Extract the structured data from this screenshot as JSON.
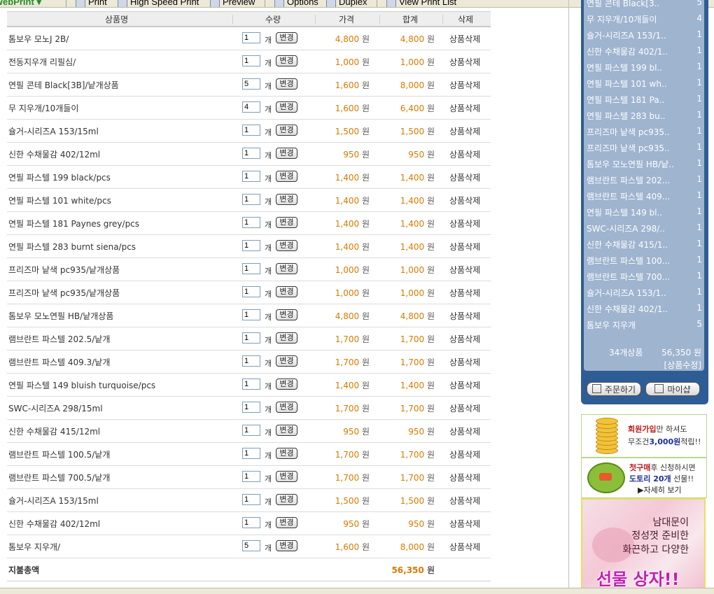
{
  "toolbar": {
    "brand": "WebPrint",
    "print": "Print",
    "high_speed_print": "High Speed Print",
    "preview": "Preview",
    "options": "Options",
    "duplex": "Duplex",
    "view_print_list": "View Print List"
  },
  "cart": {
    "headers": {
      "name": "상품명",
      "qty": "수량",
      "price": "가격",
      "total": "합계",
      "delete": "삭제"
    },
    "unit_label": "개",
    "change_label": "변경",
    "won": "원",
    "delete_label": "상품삭제",
    "items": [
      {
        "name": "톰보우 모노J 2B/",
        "qty": "1",
        "price": "4,800",
        "total": "4,800"
      },
      {
        "name": "전동지우개 리필심/",
        "qty": "1",
        "price": "1,000",
        "total": "1,000"
      },
      {
        "name": "연필 콘테 Black[3B]/낱개상품",
        "qty": "5",
        "price": "1,600",
        "total": "8,000"
      },
      {
        "name": "무 지우개/10개들이",
        "qty": "4",
        "price": "1,600",
        "total": "6,400"
      },
      {
        "name": "슐거-시리즈A 153/15ml",
        "qty": "1",
        "price": "1,500",
        "total": "1,500"
      },
      {
        "name": "신한 수채물감 402/12ml",
        "qty": "1",
        "price": "950",
        "total": "950"
      },
      {
        "name": "연필 파스텔 199 black/pcs",
        "qty": "1",
        "price": "1,400",
        "total": "1,400"
      },
      {
        "name": "연필 파스텔 101 white/pcs",
        "qty": "1",
        "price": "1,400",
        "total": "1,400"
      },
      {
        "name": "연필 파스텔 181 Paynes grey/pcs",
        "qty": "1",
        "price": "1,400",
        "total": "1,400"
      },
      {
        "name": "연필 파스텔 283 burnt siena/pcs",
        "qty": "1",
        "price": "1,400",
        "total": "1,400"
      },
      {
        "name": "프리즈마 낱색 pc935/낱개상품",
        "qty": "1",
        "price": "1,000",
        "total": "1,000"
      },
      {
        "name": "프리즈마 낱색 pc935/낱개상품",
        "qty": "1",
        "price": "1,000",
        "total": "1,000"
      },
      {
        "name": "톰보우 모노연필 HB/낱개상품",
        "qty": "1",
        "price": "4,800",
        "total": "4,800"
      },
      {
        "name": "램브란트 파스텔 202.5/낱개",
        "qty": "1",
        "price": "1,700",
        "total": "1,700"
      },
      {
        "name": "램브란트 파스텔 409.3/낱개",
        "qty": "1",
        "price": "1,700",
        "total": "1,700"
      },
      {
        "name": "연필 파스텔 149 bluish turquoise/pcs",
        "qty": "1",
        "price": "1,400",
        "total": "1,400"
      },
      {
        "name": "SWC-시리즈A 298/15ml",
        "qty": "1",
        "price": "1,700",
        "total": "1,700"
      },
      {
        "name": "신한 수채물감 415/12ml",
        "qty": "1",
        "price": "950",
        "total": "950"
      },
      {
        "name": "램브란트 파스텔 100.5/낱개",
        "qty": "1",
        "price": "1,700",
        "total": "1,700"
      },
      {
        "name": "램브란트 파스텔 700.5/낱개",
        "qty": "1",
        "price": "1,700",
        "total": "1,700"
      },
      {
        "name": "슐거-시리즈A 153/15ml",
        "qty": "1",
        "price": "1,500",
        "total": "1,500"
      },
      {
        "name": "신한 수채물감 402/12ml",
        "qty": "1",
        "price": "950",
        "total": "950"
      },
      {
        "name": "톰보우 지우개/",
        "qty": "5",
        "price": "1,600",
        "total": "8,000"
      }
    ],
    "sum_label": "지불총액",
    "sum_value": "56,350"
  },
  "side": {
    "items": [
      {
        "name": "연필 콘테 Black[3..",
        "count": "5"
      },
      {
        "name": "무 지우개/10개들이",
        "count": "4"
      },
      {
        "name": "슐거-시리즈A 153/1..",
        "count": "1"
      },
      {
        "name": "신한 수채물감 402/1..",
        "count": "1"
      },
      {
        "name": "연필 파스텔 199 bl..",
        "count": "1"
      },
      {
        "name": "연필 파스텔 101 wh..",
        "count": "1"
      },
      {
        "name": "연필 파스텔 181 Pa..",
        "count": "1"
      },
      {
        "name": "연필 파스텔 283 bu..",
        "count": "1"
      },
      {
        "name": "프리즈마 낱색 pc935..",
        "count": "1"
      },
      {
        "name": "프리즈마 낱색 pc935..",
        "count": "1"
      },
      {
        "name": "톰보우 모노연필 HB/낱..",
        "count": "1"
      },
      {
        "name": "램브란트 파스텔 202...",
        "count": "1"
      },
      {
        "name": "램브란트 파스텔 409...",
        "count": "1"
      },
      {
        "name": "연필 파스텔 149 bl..",
        "count": "1"
      },
      {
        "name": "SWC-시리즈A 298/..",
        "count": "1"
      },
      {
        "name": "신한 수채물감 415/1..",
        "count": "1"
      },
      {
        "name": "램브란트 파스텔 100...",
        "count": "1"
      },
      {
        "name": "램브란트 파스텔 700...",
        "count": "1"
      },
      {
        "name": "슐거-시리즈A 153/1..",
        "count": "1"
      },
      {
        "name": "신한 수채물감 402/1..",
        "count": "1"
      },
      {
        "name": "톰보우 지우개",
        "count": "5"
      }
    ],
    "count_label": "34개상품",
    "total": "56,350 원",
    "modify": "[상품수정]",
    "order_button": "주문하기",
    "myshop_button": "마이샵"
  },
  "promos": {
    "p1_red": "회원가입",
    "p1_rest": "만 하셔도",
    "p1_line2_pre": "무조건",
    "p1_line2_blue": "3,000원",
    "p1_line2_post": "적립!!",
    "p2_red": "첫구매",
    "p2_rest": "후 신청하시면",
    "p2_blue": "도토리 20개",
    "p2_post": " 선물!!",
    "p2_more": "▶자세히 보기",
    "p3_l1": "남대문이",
    "p3_l2": "정성껏 준비한",
    "p3_l3": "화끈하고 다양한",
    "p3_big": "선물 상자!!"
  },
  "colors": {
    "accent": "#d77a00",
    "side_bg": "#2e5d95",
    "side_list": "#9fb4cf"
  }
}
